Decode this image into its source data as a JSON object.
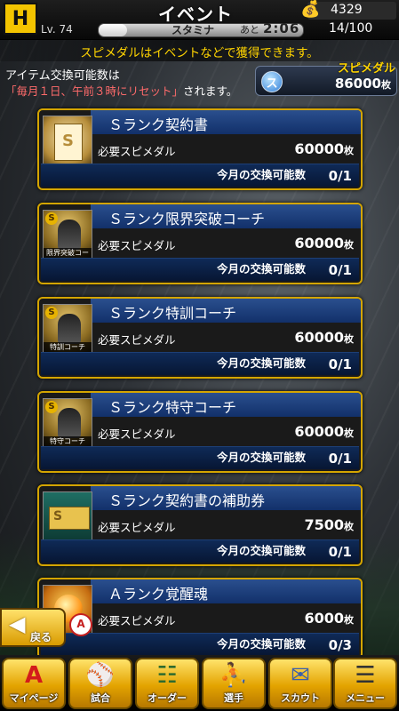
{
  "header": {
    "logo_text": "H",
    "title": "イベント",
    "level": "Lv. 74",
    "stamina_label": "スタミナ",
    "stamina_fraction": 0.14,
    "ato": "あと",
    "timer": "2:06",
    "stamina_value": "14/100",
    "coins": "4329"
  },
  "notice": "スピメダルはイベントなどで獲得できます。",
  "info": {
    "line1": "アイテム交換可能数は",
    "line2_highlight": "「毎月１日、午前３時にリセット」",
    "line2_rest": "されます。"
  },
  "medal": {
    "title": "スピメダル",
    "icon_letter": "ス",
    "value": "86000",
    "unit": "枚"
  },
  "cards": [
    {
      "name": "Ｓランク契約書",
      "req_label": "必要スピメダル",
      "req_value": "60000",
      "unit": "枚",
      "limit_label": "今月の交換可能数",
      "limit_value": "0/1",
      "thumb_caption": "",
      "thumb_badge": ""
    },
    {
      "name": "Ｓランク限界突破コーチ",
      "req_label": "必要スピメダル",
      "req_value": "60000",
      "unit": "枚",
      "limit_label": "今月の交換可能数",
      "limit_value": "0/1",
      "thumb_caption": "限界突破コーチ",
      "thumb_badge": "S"
    },
    {
      "name": "Ｓランク特訓コーチ",
      "req_label": "必要スピメダル",
      "req_value": "60000",
      "unit": "枚",
      "limit_label": "今月の交換可能数",
      "limit_value": "0/1",
      "thumb_caption": "特訓コーチ",
      "thumb_badge": "S"
    },
    {
      "name": "Ｓランク特守コーチ",
      "req_label": "必要スピメダル",
      "req_value": "60000",
      "unit": "枚",
      "limit_label": "今月の交換可能数",
      "limit_value": "0/1",
      "thumb_caption": "特守コーチ",
      "thumb_badge": "S"
    },
    {
      "name": "Ｓランク契約書の補助券",
      "req_label": "必要スピメダル",
      "req_value": "7500",
      "unit": "枚",
      "limit_label": "今月の交換可能数",
      "limit_value": "0/1",
      "thumb_caption": "",
      "thumb_badge": ""
    },
    {
      "name": "Ａランク覚醒魂",
      "req_label": "必要スピメダル",
      "req_value": "6000",
      "unit": "枚",
      "limit_label": "今月の交換可能数",
      "limit_value": "0/3",
      "thumb_caption": "",
      "thumb_badge": "A"
    }
  ],
  "back_label": "戻る",
  "nav": [
    {
      "label": "マイページ",
      "icon": "A"
    },
    {
      "label": "試合",
      "icon": "⚾"
    },
    {
      "label": "オーダー",
      "icon": "☷"
    },
    {
      "label": "選手",
      "icon": "⛹"
    },
    {
      "label": "スカウト",
      "icon": "✉"
    },
    {
      "label": "メニュー",
      "icon": "☰"
    }
  ]
}
